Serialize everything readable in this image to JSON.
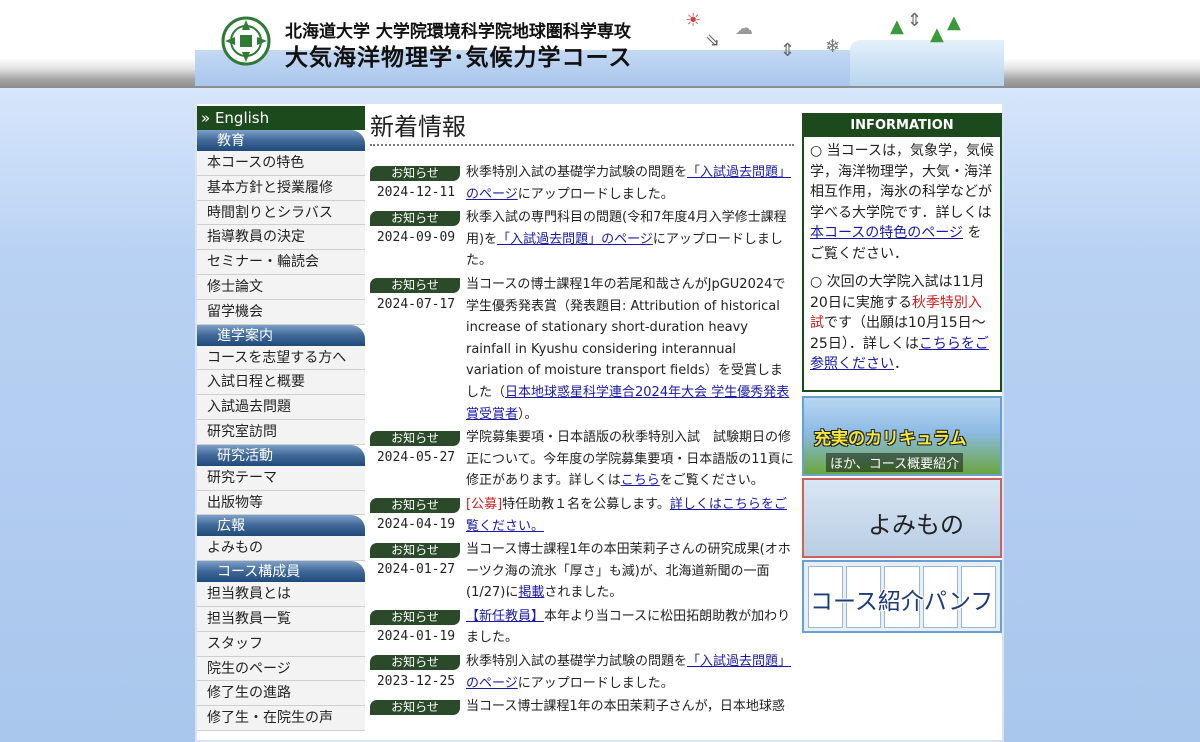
{
  "header": {
    "university_line": "北海道大学 大学院環境科学院地球圏科学専攻",
    "course_name": "大気海洋物理学･気候力学コース"
  },
  "sidebar": {
    "english_label": "» English",
    "sections": [
      {
        "heading": "教育",
        "items": [
          "本コースの特色",
          "基本方針と授業履修",
          "時間割りとシラバス",
          "指導教員の決定",
          "セミナー・輪読会",
          "修士論文",
          "留学機会"
        ]
      },
      {
        "heading": "進学案内",
        "items": [
          "コースを志望する方へ",
          "入試日程と概要",
          "入試過去問題",
          "研究室訪問"
        ]
      },
      {
        "heading": "研究活動",
        "items": [
          "研究テーマ",
          "出版物等"
        ]
      },
      {
        "heading": "広報",
        "items": [
          "よみもの"
        ]
      },
      {
        "heading": "コース構成員",
        "items": [
          "担当教員とは",
          "担当教員一覧",
          "スタッフ",
          "院生のページ",
          "修了生の進路",
          "修了生・在院生の声"
        ]
      }
    ]
  },
  "news": {
    "title": "新着情報",
    "badge_label": "お知らせ",
    "items": [
      {
        "date": "2024-12-11",
        "text_before": "秋季特別入試の基礎学力試験の問題を",
        "link": "「入試過去問題」のページ",
        "text_after": "にアップロードしました。"
      },
      {
        "date": "2024-09-09",
        "text_before": "秋季入試の専門科目の問題(令和7年度4月入学修士課程用)を",
        "link": "「入試過去問題」のページ",
        "text_after": "にアップロードしました。"
      },
      {
        "date": "2024-07-17",
        "text_before": "当コースの博士課程1年の若尾和哉さんがJpGU2024で学生優秀発表賞（発表題目: Attribution of historical increase of stationary short-duration heavy rainfall in Kyushu considering interannual variation of moisture transport fields）を受賞しました（",
        "link": "日本地球惑星科学連合2024年大会 学生優秀発表賞受賞者",
        "text_after": "）。"
      },
      {
        "date": "2024-05-27",
        "text_before": "学院募集要項・日本語版の秋季特別入試　試験期日の修正について。今年度の学院募集要項・日本語版の11頁に修正があります。詳しくは",
        "link": "こちら",
        "text_after": "をご覧ください。"
      },
      {
        "date": "2024-04-19",
        "prefix": "[公募]",
        "text_before": "特任助教１名を公募します。",
        "link": "詳しくはこちらをご覧ください。",
        "text_after": ""
      },
      {
        "date": "2024-01-27",
        "text_before": "当コース博士課程1年の本田茉莉子さんの研究成果(オホーツク海の流氷「厚さ」も減)が、北海道新聞の一面(1/27)に",
        "link": "掲載",
        "text_after": "されました。"
      },
      {
        "date": "2024-01-19",
        "text_before": "",
        "link": "【新任教員】",
        "text_after": "本年より当コースに松田拓朗助教が加わりました。"
      },
      {
        "date": "2023-12-25",
        "text_before": "秋季特別入試の基礎学力試験の問題を",
        "link": "「入試過去問題」のページ",
        "text_after": "にアップロードしました。"
      },
      {
        "date": "",
        "text_before": "当コース博士課程1年の本田茉莉子さんが，日本地球惑",
        "link": "",
        "text_after": ""
      }
    ]
  },
  "info": {
    "title": "INFORMATION",
    "p1_before": "○ 当コースは，気象学，気候学，海洋物理学，大気・海洋相互作用，海氷の科学などが学べる大学院です．詳しくは",
    "p1_link": "本コースの特色のページ",
    "p1_after": "をご覧ください．",
    "p2_before": "○ 次回の大学院入試は11月20日に実施する",
    "p2_red": "秋季特別入試",
    "p2_mid": "です（出願は10月15日〜25日）．詳しくは",
    "p2_link": "こちらをご参照ください",
    "p2_after": "．"
  },
  "banners": {
    "curriculum_title": "充実のカリキュラム",
    "curriculum_sub": "ほか、コース概要紹介",
    "reading_title": "よみもの",
    "pamphlet_title": "コース紹介パンフ"
  }
}
